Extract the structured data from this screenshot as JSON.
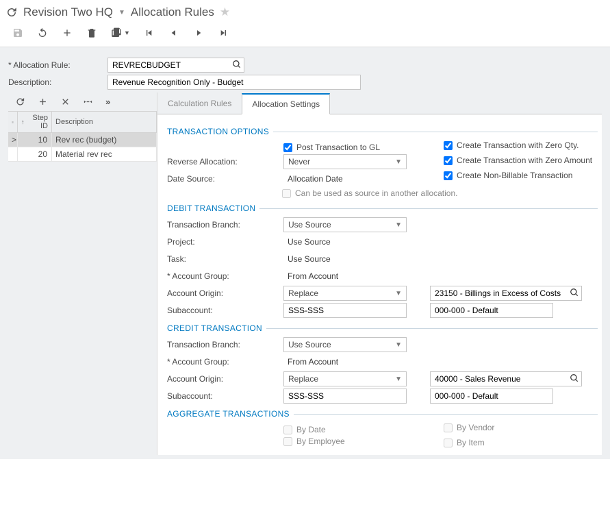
{
  "header": {
    "company": "Revision Two HQ",
    "screen": "Allocation Rules"
  },
  "form": {
    "allocation_rule_label": "Allocation Rule:",
    "allocation_rule_value": "REVRECBUDGET",
    "description_label": "Description:",
    "description_value": "Revenue Recognition Only - Budget"
  },
  "grid": {
    "headers": {
      "step": "Step ID",
      "desc": "Description"
    },
    "rows": [
      {
        "marker": ">",
        "step": "10",
        "desc": "Rev rec (budget)",
        "selected": true
      },
      {
        "marker": "",
        "step": "20",
        "desc": "Material rev rec",
        "selected": false
      }
    ]
  },
  "tabs": {
    "calc": "Calculation Rules",
    "settings": "Allocation Settings"
  },
  "sections": {
    "trans_opt": "TRANSACTION OPTIONS",
    "debit": "DEBIT TRANSACTION",
    "credit": "CREDIT TRANSACTION",
    "aggregate": "AGGREGATE TRANSACTIONS"
  },
  "trans": {
    "post_gl": "Post Transaction to GL",
    "zero_qty": "Create Transaction with Zero Qty.",
    "zero_amt": "Create Transaction with Zero Amount",
    "non_billable": "Create Non-Billable Transaction",
    "reverse_label": "Reverse Allocation:",
    "reverse_value": "Never",
    "date_source_label": "Date Source:",
    "date_source_value": "Allocation Date",
    "src_another": "Can be used as source in another allocation."
  },
  "debit": {
    "branch_label": "Transaction Branch:",
    "branch_value": "Use Source",
    "project_label": "Project:",
    "project_value": "Use Source",
    "task_label": "Task:",
    "task_value": "Use Source",
    "acct_group_label": "Account Group:",
    "acct_group_value": "From Account",
    "acct_origin_label": "Account Origin:",
    "acct_origin_value": "Replace",
    "acct_lookup": "23150 - Billings in Excess of Costs",
    "subacct_label": "Subaccount:",
    "subacct_value": "SSS-SSS",
    "subacct_lookup": "000-000 - Default"
  },
  "credit": {
    "branch_label": "Transaction Branch:",
    "branch_value": "Use Source",
    "acct_group_label": "Account Group:",
    "acct_group_value": "From Account",
    "acct_origin_label": "Account Origin:",
    "acct_origin_value": "Replace",
    "acct_lookup": "40000 - Sales Revenue",
    "subacct_label": "Subaccount:",
    "subacct_value": "SSS-SSS",
    "subacct_lookup": "000-000 - Default"
  },
  "aggregate": {
    "by_date": "By Date",
    "by_employee": "By Employee",
    "by_vendor": "By Vendor",
    "by_item": "By Item"
  }
}
